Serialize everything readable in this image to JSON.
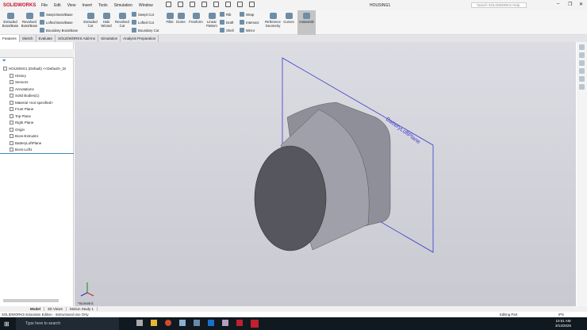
{
  "app": {
    "logo": "SOLIDWORKS",
    "document_title": "HOUSING1",
    "search_placeholder": "Search SOLIDWORKS Help"
  },
  "menu": [
    "File",
    "Edit",
    "View",
    "Insert",
    "Tools",
    "Simulation",
    "Window"
  ],
  "ribbon": {
    "features": [
      "Extruded Boss/Base",
      "Revolved Boss/Base"
    ],
    "boss_small": [
      "Swept Boss/Base",
      "Lofted Boss/Base",
      "Boundary Boss/Base"
    ],
    "cuts": [
      "Extruded Cut",
      "Hole Wizard",
      "Revolved Cut"
    ],
    "cut_small": [
      "Swept Cut",
      "Lofted Cut",
      "Boundary Cut"
    ],
    "ops": [
      "Fillet",
      "Dome",
      "Freeform",
      "Linear Pattern"
    ],
    "ops_small": [
      "Rib",
      "Draft",
      "Shell"
    ],
    "ops_small2": [
      "Wrap",
      "Intersect",
      "Mirror"
    ],
    "ref": [
      "Reference Geometry",
      "Curves",
      "Instant3D"
    ]
  },
  "command_tabs": [
    "Features",
    "Sketch",
    "Evaluate",
    "SOLIDWORKS Add-Ins",
    "Simulation",
    "Analysis Preparation"
  ],
  "tree": [
    {
      "label": "HOUSING1 (Default) <<Default>_Di",
      "indent": 0
    },
    {
      "label": "History",
      "indent": 1
    },
    {
      "label": "Sensors",
      "indent": 1
    },
    {
      "label": "Annotations",
      "indent": 1
    },
    {
      "label": "Solid Bodies(1)",
      "indent": 1
    },
    {
      "label": "Material <not specified>",
      "indent": 1
    },
    {
      "label": "Front Plane",
      "indent": 1
    },
    {
      "label": "Top Plane",
      "indent": 1
    },
    {
      "label": "Right Plane",
      "indent": 1
    },
    {
      "label": "Origin",
      "indent": 1
    },
    {
      "label": "Boss-Extrude1",
      "indent": 1
    },
    {
      "label": "BatteryLoftPlane",
      "indent": 1
    },
    {
      "label": "Boss-Loft1",
      "indent": 1
    }
  ],
  "viewport": {
    "plane_label": "BatteryLoftPlane",
    "view_label": "*Isometric",
    "plane_color": "#3a3acc"
  },
  "bottom_tabs": [
    "Model",
    "3D Views",
    "Motion Study 1"
  ],
  "status": {
    "text": "SOLIDWORKS Education Edition - Instructional Use Only",
    "mode": "Editing Part",
    "units": "IPS"
  },
  "taskbar": {
    "search_placeholder": "Type here to search",
    "time": "10:51 AM",
    "date": "3/13/2025"
  }
}
